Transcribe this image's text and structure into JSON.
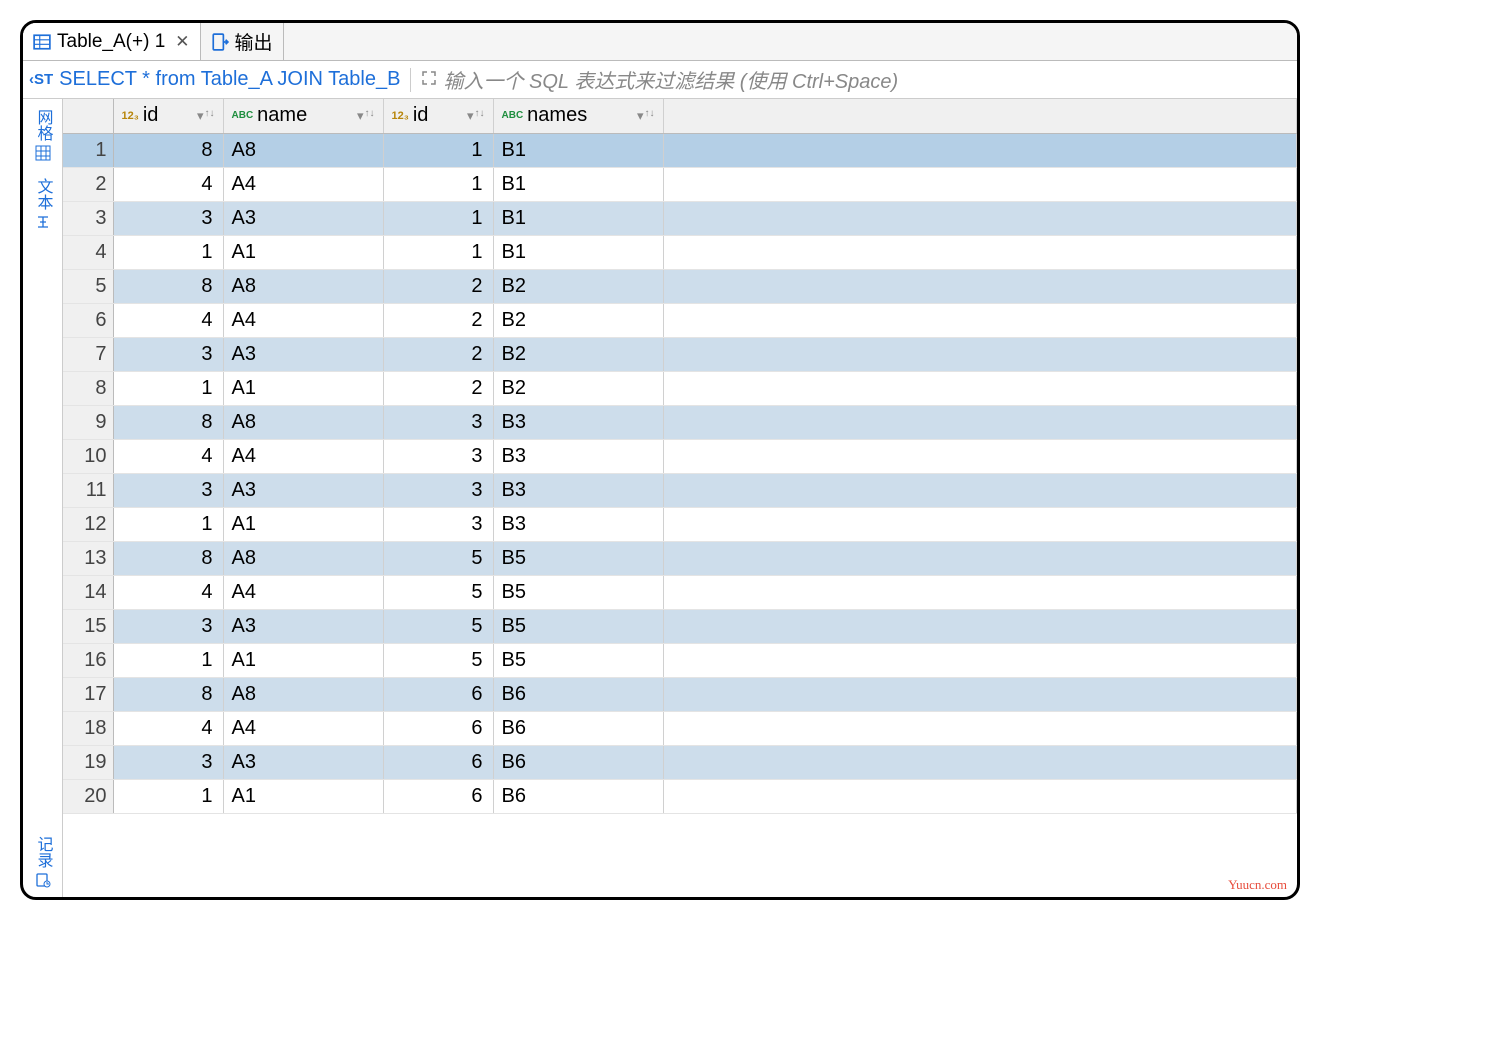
{
  "tabs": [
    {
      "label": "Table_A(+) 1",
      "active": true,
      "closable": true,
      "icon": "table"
    },
    {
      "label": "输出",
      "active": false,
      "closable": false,
      "icon": "output"
    }
  ],
  "query_bar": {
    "sql": "SELECT * from Table_A JOIN Table_B",
    "filter_placeholder": "输入一个 SQL 表达式来过滤结果 (使用 Ctrl+Space)"
  },
  "side_rail": {
    "grid": "网格",
    "text": "文本",
    "record": "记录"
  },
  "columns": [
    {
      "name": "id",
      "type": "num"
    },
    {
      "name": "name",
      "type": "abc"
    },
    {
      "name": "id",
      "type": "num"
    },
    {
      "name": "names",
      "type": "abc"
    }
  ],
  "rows": [
    {
      "n": "1",
      "c": [
        "8",
        "A8",
        "1",
        "B1"
      ]
    },
    {
      "n": "2",
      "c": [
        "4",
        "A4",
        "1",
        "B1"
      ]
    },
    {
      "n": "3",
      "c": [
        "3",
        "A3",
        "1",
        "B1"
      ]
    },
    {
      "n": "4",
      "c": [
        "1",
        "A1",
        "1",
        "B1"
      ]
    },
    {
      "n": "5",
      "c": [
        "8",
        "A8",
        "2",
        "B2"
      ]
    },
    {
      "n": "6",
      "c": [
        "4",
        "A4",
        "2",
        "B2"
      ]
    },
    {
      "n": "7",
      "c": [
        "3",
        "A3",
        "2",
        "B2"
      ]
    },
    {
      "n": "8",
      "c": [
        "1",
        "A1",
        "2",
        "B2"
      ]
    },
    {
      "n": "9",
      "c": [
        "8",
        "A8",
        "3",
        "B3"
      ]
    },
    {
      "n": "10",
      "c": [
        "4",
        "A4",
        "3",
        "B3"
      ]
    },
    {
      "n": "11",
      "c": [
        "3",
        "A3",
        "3",
        "B3"
      ]
    },
    {
      "n": "12",
      "c": [
        "1",
        "A1",
        "3",
        "B3"
      ]
    },
    {
      "n": "13",
      "c": [
        "8",
        "A8",
        "5",
        "B5"
      ]
    },
    {
      "n": "14",
      "c": [
        "4",
        "A4",
        "5",
        "B5"
      ]
    },
    {
      "n": "15",
      "c": [
        "3",
        "A3",
        "5",
        "B5"
      ]
    },
    {
      "n": "16",
      "c": [
        "1",
        "A1",
        "5",
        "B5"
      ]
    },
    {
      "n": "17",
      "c": [
        "8",
        "A8",
        "6",
        "B6"
      ]
    },
    {
      "n": "18",
      "c": [
        "4",
        "A4",
        "6",
        "B6"
      ]
    },
    {
      "n": "19",
      "c": [
        "3",
        "A3",
        "6",
        "B6"
      ]
    },
    {
      "n": "20",
      "c": [
        "1",
        "A1",
        "6",
        "B6"
      ]
    }
  ],
  "watermark": "Yuucn.com"
}
